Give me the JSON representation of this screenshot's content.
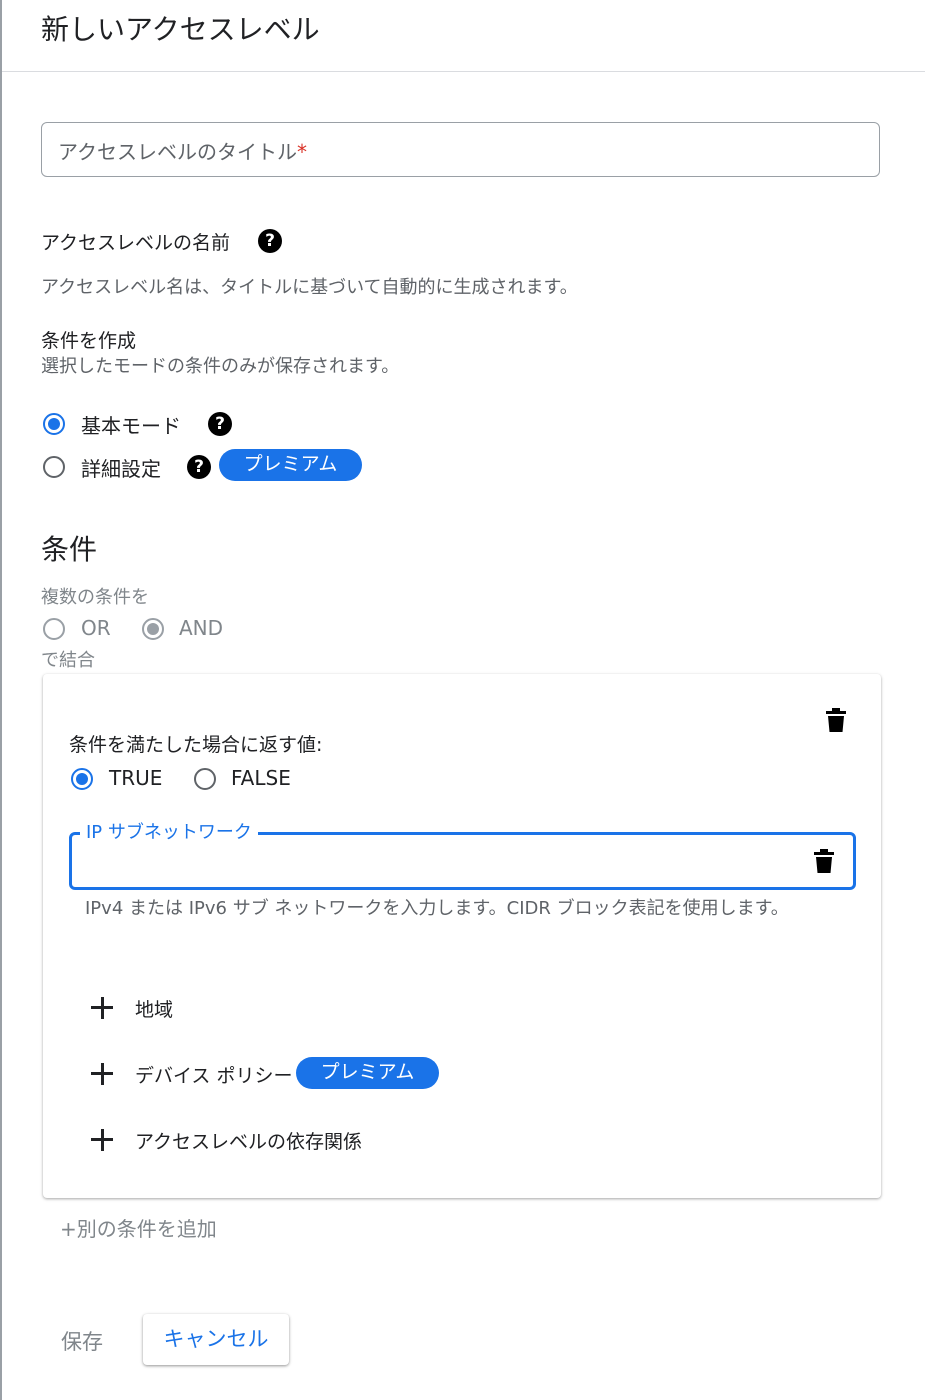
{
  "header": {
    "title": "新しいアクセスレベル"
  },
  "title_field": {
    "placeholder": "アクセスレベルのタイトル",
    "required_mark": "*"
  },
  "name_section": {
    "label": "アクセスレベルの名前",
    "description": "アクセスレベル名は、タイトルに基づいて自動的に生成されます。"
  },
  "create_conditions": {
    "label": "条件を作成",
    "description": "選択したモードの条件のみが保存されます。",
    "modes": [
      {
        "label": "基本モード",
        "selected": true
      },
      {
        "label": "詳細設定",
        "selected": false,
        "badge": "プレミアム"
      }
    ]
  },
  "conditions": {
    "heading": "条件",
    "combine_prefix": "複数の条件を",
    "combine_suffix": "で結合",
    "combine_options": [
      {
        "label": "OR",
        "selected": false
      },
      {
        "label": "AND",
        "selected": true
      }
    ],
    "card": {
      "return_label": "条件を満たした場合に返す値:",
      "return_options": [
        {
          "label": "TRUE",
          "selected": true
        },
        {
          "label": "FALSE",
          "selected": false
        }
      ],
      "ip_field": {
        "label": "IP サブネットワーク",
        "value": "",
        "hint": "IPv4 または IPv6 サブ ネットワークを入力します。CIDR ブロック表記を使用します。"
      },
      "add_items": [
        {
          "label": "地域"
        },
        {
          "label": "デバイス ポリシー",
          "badge": "プレミアム"
        },
        {
          "label": "アクセスレベルの依存関係"
        }
      ]
    },
    "add_another": "+別の条件を追加"
  },
  "actions": {
    "save": "保存",
    "cancel": "キャンセル"
  },
  "colors": {
    "accent": "#1a73e8",
    "required": "#d93025"
  }
}
